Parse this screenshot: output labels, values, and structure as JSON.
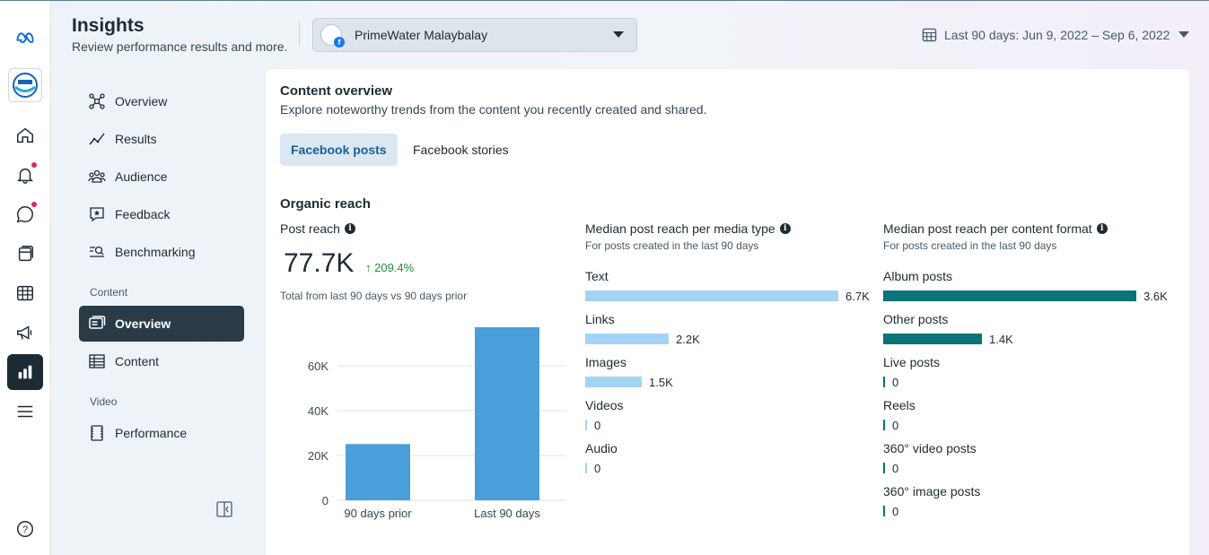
{
  "header": {
    "title": "Insights",
    "subtitle": "Review performance results and more.",
    "page_name": "PrimeWater Malaybalay",
    "date_range": "Last 90 days: Jun 9, 2022 – Sep 6, 2022"
  },
  "rail": {
    "icons": [
      "meta-logo-icon",
      "page-avatar",
      "home-icon",
      "bell-icon",
      "chat-icon",
      "posts-icon",
      "table-icon",
      "megaphone-icon",
      "insights-icon",
      "menu-icon",
      "help-icon"
    ]
  },
  "nav": {
    "items": [
      {
        "label": "Overview"
      },
      {
        "label": "Results"
      },
      {
        "label": "Audience"
      },
      {
        "label": "Feedback"
      },
      {
        "label": "Benchmarking"
      }
    ],
    "content_section": "Content",
    "content_items": [
      {
        "label": "Overview"
      },
      {
        "label": "Content"
      }
    ],
    "video_section": "Video",
    "video_items": [
      {
        "label": "Performance"
      }
    ]
  },
  "card": {
    "title": "Content overview",
    "subtitle": "Explore noteworthy trends from the content you recently created and shared.",
    "tabs": [
      {
        "label": "Facebook posts",
        "active": true
      },
      {
        "label": "Facebook stories",
        "active": false
      }
    ],
    "section": "Organic reach",
    "post_reach": {
      "label": "Post reach",
      "value": "77.7K",
      "delta": "209.4%",
      "note": "Total from last 90 days vs 90 days prior"
    },
    "media_type": {
      "label": "Median post reach per media type",
      "note": "For posts created in the last 90 days",
      "color": "#a4d4f4",
      "rows": [
        {
          "label": "Text",
          "value": 6.7,
          "display": "6.7K"
        },
        {
          "label": "Links",
          "value": 2.2,
          "display": "2.2K"
        },
        {
          "label": "Images",
          "value": 1.5,
          "display": "1.5K"
        },
        {
          "label": "Videos",
          "value": 0,
          "display": "0"
        },
        {
          "label": "Audio",
          "value": 0,
          "display": "0"
        }
      ]
    },
    "content_format": {
      "label": "Median post reach per content format",
      "note": "For posts created in the last 90 days",
      "color": "#0a7478",
      "rows": [
        {
          "label": "Album posts",
          "value": 3.6,
          "display": "3.6K"
        },
        {
          "label": "Other posts",
          "value": 1.4,
          "display": "1.4K"
        },
        {
          "label": "Live posts",
          "value": 0,
          "display": "0"
        },
        {
          "label": "Reels",
          "value": 0,
          "display": "0"
        },
        {
          "label": "360° video posts",
          "value": 0,
          "display": "0"
        },
        {
          "label": "360° image posts",
          "value": 0,
          "display": "0"
        }
      ]
    }
  },
  "chart_data": {
    "type": "bar",
    "categories": [
      "90 days prior",
      "Last 90 days"
    ],
    "values": [
      25100,
      77700
    ],
    "ylim": [
      0,
      60000
    ],
    "yticks": [
      "0",
      "20K",
      "40K",
      "60K"
    ],
    "yticks_values": [
      0,
      20000,
      40000,
      60000
    ],
    "color": "#4a9fda",
    "grid": true
  }
}
